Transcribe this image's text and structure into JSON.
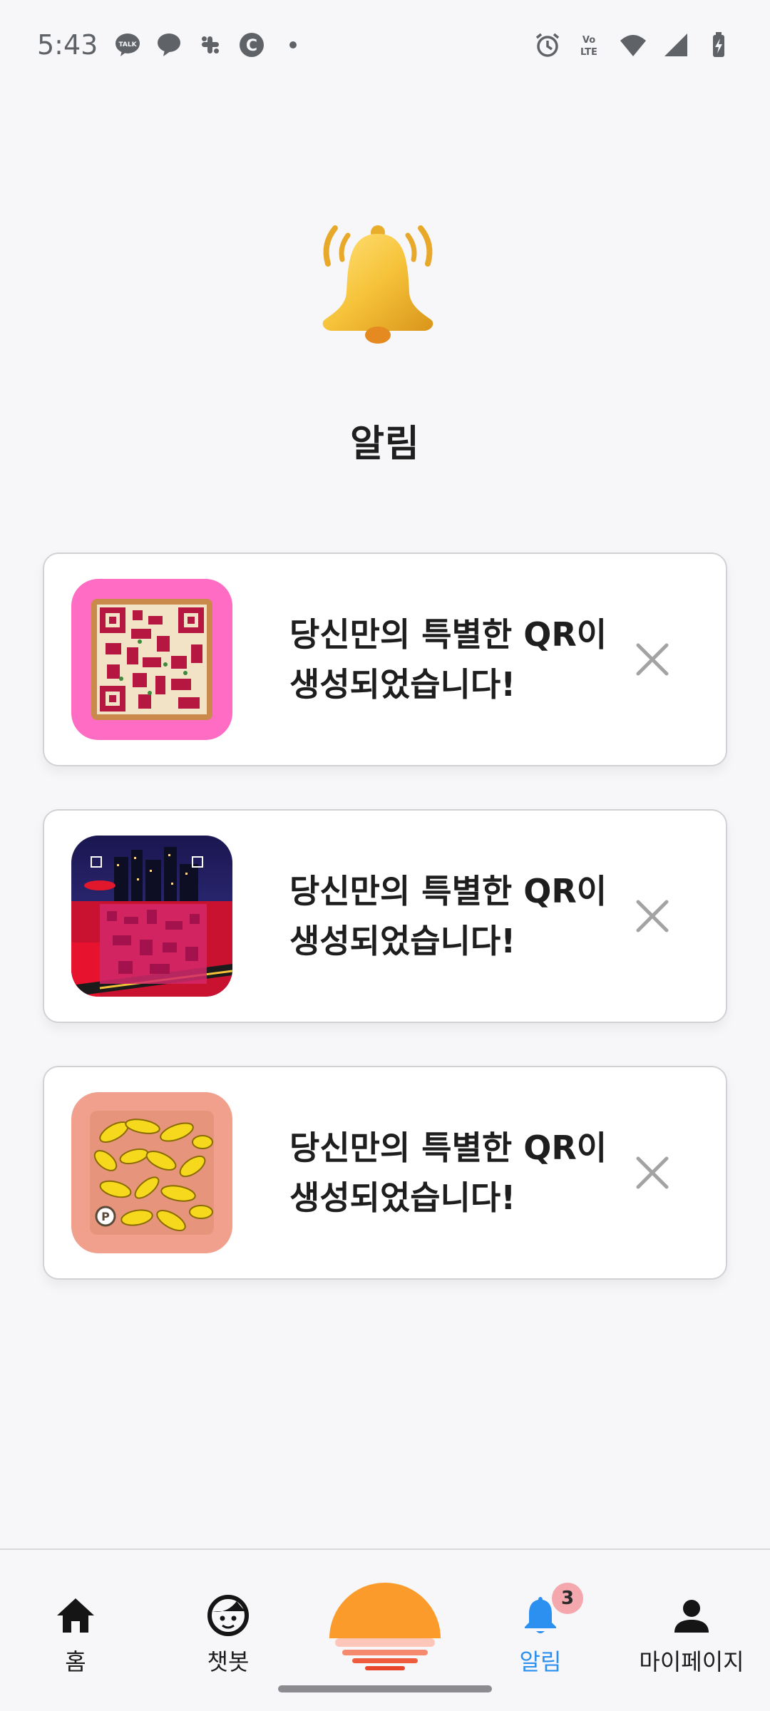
{
  "status_bar": {
    "time": "5:43",
    "left_icons": [
      "kakaotalk-icon",
      "chat-bubble-icon",
      "slack-icon",
      "c-app-icon",
      "dot-icon"
    ],
    "right_icons": [
      "alarm-icon",
      "volte-icon",
      "wifi-icon",
      "signal-icon",
      "battery-icon"
    ],
    "volte_label": "Vo LTE"
  },
  "header": {
    "title": "알림",
    "hero_icon": "bell-icon"
  },
  "notifications": [
    {
      "message": "당신만의 특별한 QR이\n생성되었습니다!",
      "thumbnail": "pizza-qr-thumbnail"
    },
    {
      "message": "당신만의 특별한 QR이\n생성되었습니다!",
      "thumbnail": "city-qr-thumbnail"
    },
    {
      "message": "당신만의 특별한 QR이\n생성되었습니다!",
      "thumbnail": "banana-qr-thumbnail"
    }
  ],
  "bottom_nav": {
    "items": [
      {
        "label": "홈",
        "icon": "home-icon"
      },
      {
        "label": "챗봇",
        "icon": "face-icon"
      },
      {
        "label": "",
        "icon": "sunset-logo-icon"
      },
      {
        "label": "알림",
        "icon": "bell-icon",
        "badge": "3",
        "active": true
      },
      {
        "label": "마이페이지",
        "icon": "person-icon"
      }
    ]
  },
  "colors": {
    "accent": "#2b90f0",
    "bell_gold": "#f3b82e",
    "badge": "#f4a8ad",
    "logo_orange": "#fb9b2c"
  }
}
